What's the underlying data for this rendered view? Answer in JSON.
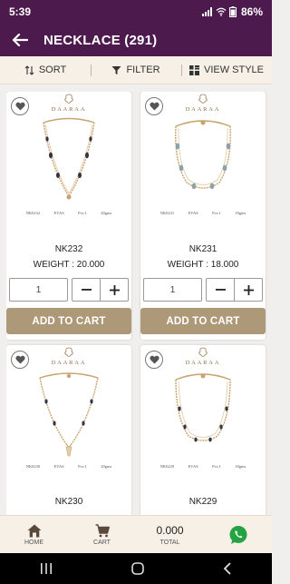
{
  "status": {
    "time": "5:39",
    "battery": "86%"
  },
  "header": {
    "title": "NECKLACE (291)"
  },
  "toolbar": {
    "sort_label": "SORT",
    "filter_label": "FILTER",
    "view_label": "VIEW STYLE"
  },
  "brand": {
    "name": "DAARAA"
  },
  "products": [
    {
      "name": "NK232",
      "weight": "WEIGHT : 20.000",
      "quantity": "1",
      "code": "NK0232",
      "collection": "EVAS",
      "pcs": "Pcs:1",
      "gms": "20gms",
      "add_label": "ADD TO CART",
      "bead_color": "#333344"
    },
    {
      "name": "NK231",
      "weight": "WEIGHT : 18.000",
      "quantity": "1",
      "code": "NK0231",
      "collection": "EVAS",
      "pcs": "Pcs:1",
      "gms": "18gms",
      "add_label": "ADD TO CART",
      "bead_color": "#8ea1a8"
    },
    {
      "name": "NK230",
      "code": "NK0230",
      "collection": "EVAS",
      "pcs": "Pcs:1",
      "gms": "20gms",
      "bead_color": "#333344"
    },
    {
      "name": "NK229",
      "code": "NK0229",
      "collection": "EVAS",
      "pcs": "Pcs:1",
      "gms": "18gms",
      "bead_color": "#333344"
    }
  ],
  "bottom_nav": {
    "home_label": "HOME",
    "cart_label": "CART",
    "total_value": "0.000",
    "total_label": "TOTAL"
  },
  "colors": {
    "primary": "#4c1a4d",
    "accent": "#ad9877",
    "toolbar_bg": "#f6f0e6",
    "whatsapp": "#25a244"
  },
  "icons": [
    "back-arrow-icon",
    "sort-icon",
    "filter-icon",
    "view-style-icon",
    "heart-icon",
    "minus-icon",
    "plus-icon",
    "home-icon",
    "cart-icon",
    "whatsapp-icon"
  ]
}
